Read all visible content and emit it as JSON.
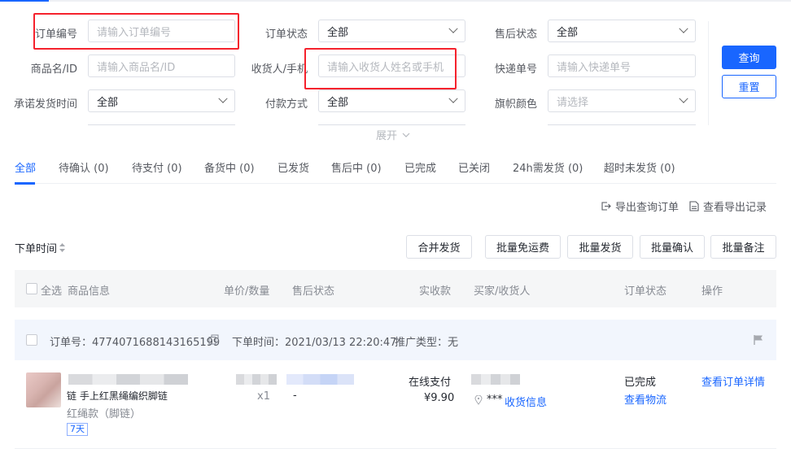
{
  "filters": {
    "order_no": {
      "label": "订单编号",
      "placeholder": "请输入订单编号"
    },
    "order_status": {
      "label": "订单状态",
      "value": "全部"
    },
    "after_sale_status": {
      "label": "售后状态",
      "value": "全部"
    },
    "product": {
      "label": "商品名/ID",
      "placeholder": "请输入商品名/ID"
    },
    "receiver": {
      "label": "收货人/手机",
      "placeholder": "请输入收货人姓名或手机"
    },
    "tracking_no": {
      "label": "快递单号",
      "placeholder": "请输入快递单号"
    },
    "ship_time": {
      "label": "承诺发货时间",
      "value": "全部"
    },
    "pay_method": {
      "label": "付款方式",
      "value": "全部"
    },
    "flag_color": {
      "label": "旗帜颜色",
      "placeholder": "请选择"
    },
    "expand": "展开"
  },
  "actions": {
    "query": "查询",
    "reset": "重置"
  },
  "tabs": [
    {
      "label": "全部"
    },
    {
      "label": "待确认",
      "count": "(0)"
    },
    {
      "label": "待支付",
      "count": "(0)"
    },
    {
      "label": "备货中",
      "count": "(0)"
    },
    {
      "label": "已发货"
    },
    {
      "label": "售后中",
      "count": "(0)"
    },
    {
      "label": "已完成"
    },
    {
      "label": "已关闭"
    },
    {
      "label": "24h需发货",
      "count": "(0)"
    },
    {
      "label": "超时未发货",
      "count": "(0)"
    }
  ],
  "export": {
    "export_orders": "导出查询订单",
    "view_export": "查看导出记录"
  },
  "sort": {
    "label": "下单时间",
    "icon": "sort-icon"
  },
  "bulk": {
    "merge": "合并发货",
    "free_shipping": "批量免运费",
    "ship": "批量发货",
    "confirm": "批量确认",
    "remark": "批量备注"
  },
  "table_header": {
    "select_all": "全选",
    "product_info": "商品信息",
    "price_qty": "单价/数量",
    "after_sale": "售后状态",
    "paid": "实收款",
    "buyer": "买家/收货人",
    "status": "订单状态",
    "ops": "操作"
  },
  "order": {
    "order_no_text": "订单号：4774071688143165199",
    "order_time_text": "下单时间：2021/03/13 22:20:47",
    "promo_text": "推广类型：无",
    "product_title": "链 手上红黑绳编织脚链",
    "variant": "红绳款（脚链）",
    "badge": "7天",
    "qty": "x1",
    "after_sale": "-",
    "pay_label": "在线支付",
    "amount": "¥9.90",
    "buyer_masked": "***",
    "receiver_link": "收货信息",
    "status": "已完成",
    "logistics": "查看物流",
    "detail": "查看订单详情"
  },
  "colors": {
    "accent": "#1966ff",
    "highlight": "#f5222d"
  }
}
